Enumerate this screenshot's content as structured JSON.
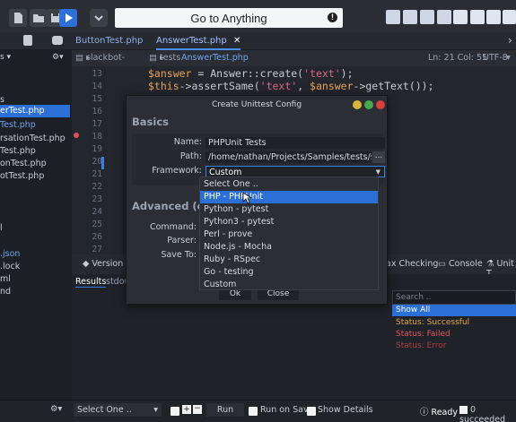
{
  "toolbar": {
    "goto_label": "Go to Anything"
  },
  "tabs": [
    {
      "label": "ButtonTest.php"
    },
    {
      "label": "AnswerTest.php"
    }
  ],
  "breadcrumb": {
    "project": "slackbot-php",
    "folder": "tests",
    "file": "AnswerTest.php",
    "position": "Ln: 21 Col: 55",
    "encoding": "UTF-8"
  },
  "sidebar": {
    "items": [
      {
        "label": "s"
      },
      {
        "label": "erTest.php"
      },
      {
        "label": "Test.php"
      },
      {
        "label": "rsationTest.php"
      },
      {
        "label": "Test.php"
      },
      {
        "label": "onTest.php"
      },
      {
        "label": "otTest.php"
      },
      {
        "label": "l"
      },
      {
        "label": ".json"
      },
      {
        "label": ".lock"
      },
      {
        "label": "ml"
      },
      {
        "label": "nd"
      }
    ]
  },
  "editor": {
    "lines": [
      "13",
      "14",
      "15",
      "16",
      "17",
      "18",
      "19",
      "20",
      "21",
      "22",
      "23",
      "24",
      "25",
      "26",
      "27"
    ],
    "code_line_1": "$answer = Answer::create('text');",
    "code_line_2": "$this->assertSame('text', $answer->getText());"
  },
  "dialog": {
    "title": "Create Unittest Config",
    "basics_heading": "Basics",
    "name_label": "Name:",
    "name_value": "PHPUnit Tests",
    "path_label": "Path:",
    "path_value": "/home/nathan/Projects/Samples/tests/slackbo",
    "path_button": "...",
    "framework_label": "Framework:",
    "framework_value": "Custom",
    "advanced_heading": "Advanced (opti",
    "command_label": "Command:",
    "parser_label": "Parser:",
    "saveto_label": "Save To:",
    "ok_label": "Ok",
    "close_label": "Close",
    "framework_options": [
      "Select One ..",
      "PHP - PHPUnit",
      "Python - pytest",
      "Python3 - pytest",
      "Perl - prove",
      "Node.js - Mocha",
      "Ruby - RSpec",
      "Go - testing",
      "Custom"
    ],
    "highlighted_option": "PHP - PHPUnit"
  },
  "bottom_panel": {
    "tab_version": "Version C",
    "tab_syntax": "ax Checking",
    "tab_console": "Console",
    "tab_unit": "Unit T",
    "results_tab": "Results",
    "stdout_tab": "stdou",
    "search_placeholder": "Search ..",
    "filters": [
      {
        "label": "Show All",
        "color": "#ffffff"
      },
      {
        "label": "Status: Successful",
        "color": "#e0a84a"
      },
      {
        "label": "Status: Failed",
        "color": "#e05a5a"
      },
      {
        "label": "Status: Error",
        "color": "#b04040"
      }
    ]
  },
  "statusbar": {
    "select_value": "Select One ..",
    "run_label": "Run",
    "run_on_save": "Run on Save",
    "show_details": "Show Details",
    "ready": "Ready",
    "succeeded": "0 succeeded"
  },
  "colors": {
    "accent": "#2c6fd6",
    "background": "#1f2228"
  }
}
